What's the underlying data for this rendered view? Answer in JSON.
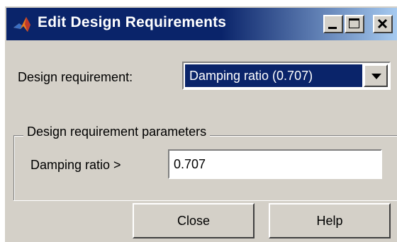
{
  "window": {
    "title": "Edit Design Requirements",
    "app_icon": "matlab-logo-icon",
    "controls": [
      "minimize-icon",
      "maximize-icon",
      "close-icon"
    ]
  },
  "requirement": {
    "label": "Design requirement:",
    "selected": "Damping ratio (0.707)"
  },
  "parameters": {
    "group_title": "Design requirement parameters",
    "damping_label": "Damping ratio  >",
    "damping_value": "0.707"
  },
  "buttons": {
    "close_label": "Close",
    "help_label": "Help"
  },
  "colors": {
    "title_bar": "#0a246a",
    "selection": "#0a246a",
    "face": "#d4d0c8"
  }
}
